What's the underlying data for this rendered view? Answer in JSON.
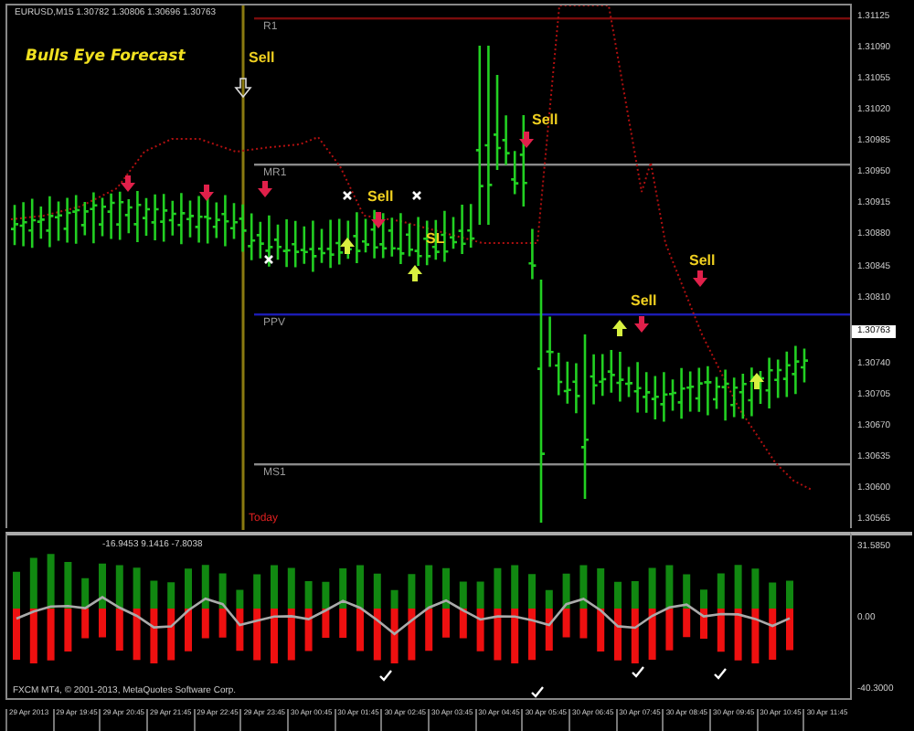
{
  "chart": {
    "header": "EURUSD,M15  1.30782 1.30806 1.30696 1.30763",
    "title": "Bulls Eye Forecast",
    "signals": [
      "Sell",
      "Sell",
      "SL",
      "Sell",
      "Sell",
      "Sell"
    ],
    "levels": [
      {
        "label": "R1",
        "color": "#7a0c0c"
      },
      {
        "label": "MR1",
        "color": "#8a8a8a"
      },
      {
        "label": "PPV",
        "color": "#1c1cb4"
      },
      {
        "label": "MS1",
        "color": "#8a8a8a"
      }
    ],
    "today": "Today"
  },
  "price_axis": {
    "labels": [
      "1.31125",
      "1.31090",
      "1.31055",
      "1.31020",
      "1.30985",
      "1.30950",
      "1.30915",
      "1.30880",
      "1.30845",
      "1.30810",
      "1.30740",
      "1.30705",
      "1.30670",
      "1.30635",
      "1.30600",
      "1.30565"
    ],
    "current": "1.30763"
  },
  "indicator": {
    "header": "-16.9453 9.1416 -7.8038",
    "labels": [
      "31.5850",
      "0.00",
      "-40.3000"
    ],
    "copyright": "FXCM MT4, © 2001-2013, MetaQuotes Software Corp."
  },
  "time_axis": [
    "29 Apr 2013",
    "29 Apr 19:45",
    "29 Apr 20:45",
    "29 Apr 21:45",
    "29 Apr 22:45",
    "29 Apr 23:45",
    "30 Apr 00:45",
    "30 Apr 01:45",
    "30 Apr 02:45",
    "30 Apr 03:45",
    "30 Apr 04:45",
    "30 Apr 05:45",
    "30 Apr 06:45",
    "30 Apr 07:45",
    "30 Apr 08:45",
    "30 Apr 09:45",
    "30 Apr 10:45",
    "30 Apr 11:45"
  ]
}
